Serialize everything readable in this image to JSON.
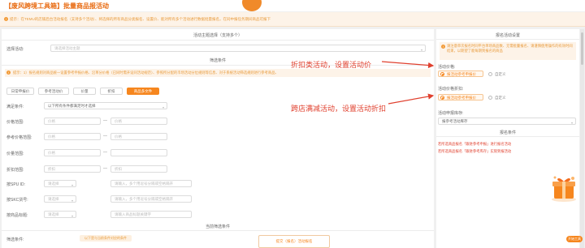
{
  "header": {
    "title": "【废风跨境工具箱】批量商品报活动"
  },
  "notice_top": "提示：在TEMU的店铺后台活动报名（支持多个活动）、将选择的所有商品分类报名、设置价、能对所有多个活动进行数据批量报名，在同中报任务期间商品可报下",
  "left": {
    "theme_section": "活动主题选择（支持多个）",
    "theme_label": "选择活动:",
    "theme_placeholder": "请选择活动主题",
    "filter_section": "筛选条件",
    "notice2": "提示：1）报名规则对商品统一设置参考申报价格、沿革分价格（已同时需开设同活动规范）、参照所分配的市场活动分位规则等信息、对于系统活动筛选规则进行参考商品、",
    "tabs": [
      "日常申报价",
      "参考活动价",
      "价量",
      "折扣",
      "商品多文件"
    ],
    "rows": [
      {
        "label": "满足条件:",
        "value": "以下所有条件都满足时才选择"
      },
      {
        "label": "价格范围:",
        "from": "价格",
        "to": "价格"
      },
      {
        "label": "参考价格范围:",
        "from": "价格",
        "to": "价格"
      },
      {
        "label": "价量范围:",
        "from": "价格",
        "to": ""
      },
      {
        "label": "折扣范围:",
        "from": "折扣",
        "to": "折扣"
      }
    ],
    "spu": {
      "label": "按SPU ID:",
      "select": "请选择",
      "input": "请输入，多个用逗号分隔或空格隔开"
    },
    "sku": {
      "label": "按SKC货号:",
      "select": "请选择",
      "input": "请输入，多个用逗号分隔或空格隔开"
    },
    "title_search": {
      "label": "按商品标题:",
      "select": "请选择",
      "input": "请输入商品标题关键字"
    },
    "other_section": "当前筛选条件",
    "bottom_label": "筛选条件:",
    "bottom_tag": "以下是与当前条件对应的条件"
  },
  "right": {
    "section_title": "报名活动设置",
    "notice": "请注意单次报名时同平台单场商品数、无需批量报名、请谨慎使用操作的有效时间结束，以期望了能每期到报名的商品",
    "discount_label": "活动价格:",
    "discount_opts": [
      "报活动参考申报价",
      "自定义"
    ],
    "fullreduce_label": "活动价格折扣:",
    "fullreduce_opts": [
      "报活动参考申报价",
      "自定义"
    ],
    "stock_label": "活动申报库存:",
    "stock_value": "报参考活动库存",
    "cond_title": "报名条件",
    "links": [
      "若所选商品报名「跟进参考申报」进行报名活动",
      "若所选商品报名「跟进参考库存」实际到报活动"
    ]
  },
  "annotations": {
    "discount": "折扣类活动，设置活动价",
    "fullreduce": "跨店满减活动，设置活动折扣",
    "colors": {
      "arrow": "#e0402e"
    }
  },
  "footer": {
    "submit": "提交（报名）活动报名",
    "corner": "开始工具"
  },
  "colors": {
    "accent": "#f6861e",
    "annotation": "#e0402e"
  }
}
